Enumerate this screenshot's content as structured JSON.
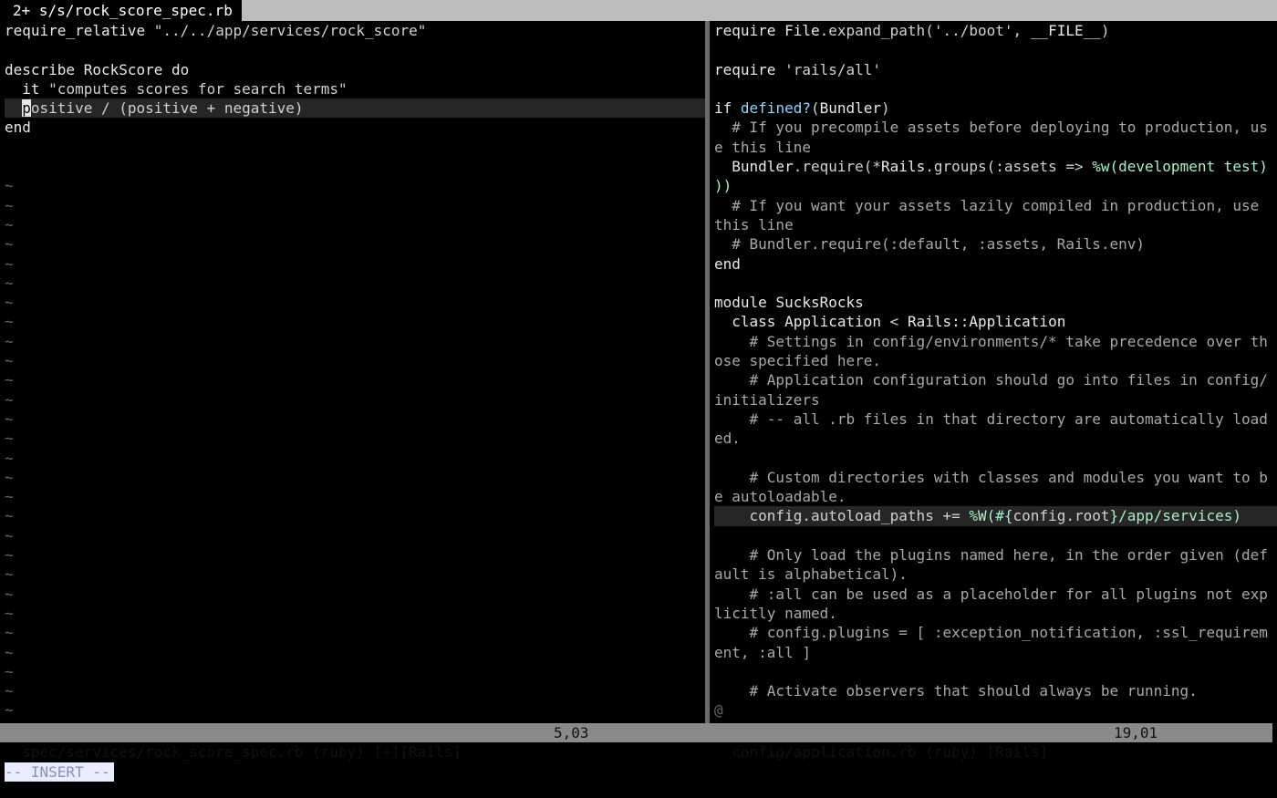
{
  "tabline": {
    "active_tab": "2+ s/s/rock_score_spec.rb"
  },
  "left": {
    "line1": {
      "a": "require_relative ",
      "b": "\"../../app/services/rock_score\""
    },
    "line3": {
      "a": "describe ",
      "b": "RockScore",
      "c": " do"
    },
    "line4": {
      "a": "  it ",
      "b": "\"computes scores for search terms\""
    },
    "line5": {
      "indent": "  ",
      "cursor": "p",
      "rest": "ositive / (positive + negative)"
    },
    "line6": "end",
    "tilde": "~",
    "status": {
      "file": "spec/services/rock_score_spec.rb (ruby) [+][Rails]",
      "pos": "5,03"
    }
  },
  "right": {
    "r1": {
      "a": "require ",
      "b": "File",
      "c": ".expand_path(",
      "d": "'../boot'",
      "e": ", ",
      "f": "__FILE__",
      "g": ")"
    },
    "r3": {
      "a": "require ",
      "b": "'rails/all'"
    },
    "r5": {
      "a": "if ",
      "b": "defined?",
      "c": "(",
      "d": "Bundler",
      "e": ")"
    },
    "r6": "  # If you precompile assets before deploying to production, us",
    "r7": "e this line",
    "r8": {
      "a": "  ",
      "b": "Bundler",
      "c": ".require(*",
      "d": "Rails",
      "e": ".groups(:assets => ",
      "f": "%w(development test)"
    },
    "r9": "))",
    "r10": "  # If you want your assets lazily compiled in production, use",
    "r11": "this line",
    "r12": "  # Bundler.require(:default, :assets, Rails.env)",
    "r13": "end",
    "r15": {
      "a": "module ",
      "b": "SucksRocks"
    },
    "r16": {
      "a": "  class ",
      "b": "Application",
      "c": " < ",
      "d": "Rails::Application"
    },
    "r17": "    # Settings in config/environments/* take precedence over th",
    "r18": "ose specified here.",
    "r19": "    # Application configuration should go into files in config/",
    "r20": "initializers",
    "r21": "    # -- all .rb files in that directory are automatically load",
    "r22": "ed.",
    "r24": "    # Custom directories with classes and modules you want to b",
    "r25": "e autoloadable.",
    "r26": {
      "a": "    config.autoload_paths += ",
      "b": "%W(#{",
      "c": "config.root",
      "d": "}/app/services)"
    },
    "r28": "    # Only load the plugins named here, in the order given (def",
    "r29": "ault is alphabetical).",
    "r30": "    # :all can be used as a placeholder for all plugins not exp",
    "r31": "licitly named.",
    "r32": "    # config.plugins = [ :exception_notification, :ssl_requirem",
    "r33": "ent, :all ]",
    "r35": "    # Activate observers that should always be running.",
    "r36": "@",
    "status": {
      "file": "config/application.rb (ruby) [Rails]",
      "pos": "19,01"
    }
  },
  "mode": "-- INSERT --"
}
